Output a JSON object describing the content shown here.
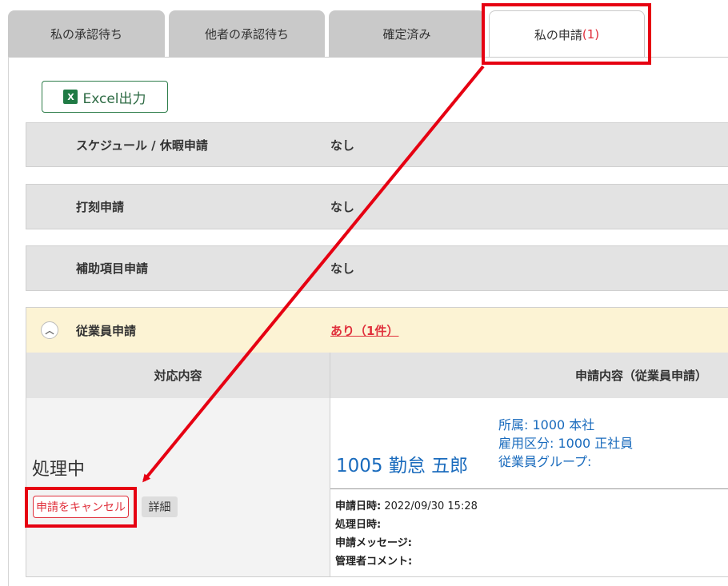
{
  "tabs": [
    {
      "label": "私の承認待ち",
      "count": ""
    },
    {
      "label": "他者の承認待ち",
      "count": ""
    },
    {
      "label": "確定済み",
      "count": ""
    },
    {
      "label": "私の申請",
      "count": "(1)"
    }
  ],
  "excel_button": {
    "label": "Excel出力",
    "icon": "excel-icon"
  },
  "sections": [
    {
      "label": "スケジュール / 休暇申請",
      "value": "なし"
    },
    {
      "label": "打刻申請",
      "value": "なし"
    },
    {
      "label": "補助項目申請",
      "value": "なし"
    },
    {
      "label": "従業員申請",
      "value": "あり（1件）"
    }
  ],
  "table": {
    "headers": [
      "対応内容",
      "申請内容（従業員申請）"
    ],
    "status": "処理中",
    "cancel_button": "申請をキャンセル",
    "detail_button": "詳細",
    "employee": {
      "name": "1005 勤怠 五郎",
      "dept": "所属: 1000 本社",
      "employment": "雇用区分: 1000 正社員",
      "group": "従業員グループ:"
    },
    "meta": {
      "applied_label": "申請日時:",
      "applied_value": "2022/09/30 15:28",
      "processed_label": "処理日時:",
      "message_label": "申請メッセージ:",
      "comment_label": "管理者コメント:"
    }
  },
  "colors": {
    "highlight": "#e60012",
    "link": "#1a6bbd",
    "alert": "#e0303c",
    "excel": "#1f7a44"
  }
}
